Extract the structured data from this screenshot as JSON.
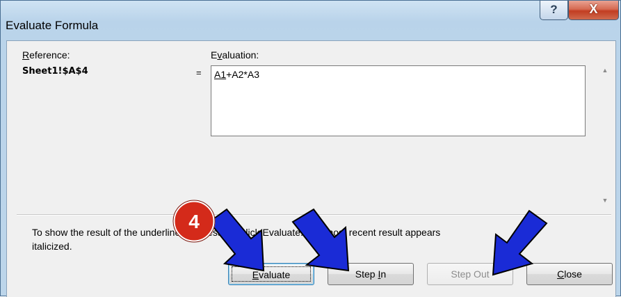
{
  "window": {
    "title": "Evaluate Formula",
    "help_glyph": "?",
    "close_glyph": "X"
  },
  "reference": {
    "label_access": "R",
    "label_rest": "eference:",
    "value": "Sheet1!$A$4",
    "equals": "="
  },
  "evaluation": {
    "label_pre": "E",
    "label_access": "v",
    "label_rest": "aluation:",
    "formula_underlined": "A1",
    "formula_rest": "+A2*A3"
  },
  "help_text": {
    "line1": "To show the result of the underlined expression, click Evaluate.  The most recent result appears",
    "line2": "italicized."
  },
  "buttons": {
    "evaluate": {
      "access": "E",
      "rest": "valuate"
    },
    "step_in": {
      "pre": "Step ",
      "access": "I",
      "rest": "n"
    },
    "step_out": {
      "label": "Step Out",
      "disabled": true
    },
    "close": {
      "access": "C",
      "rest": "lose"
    }
  },
  "callout": {
    "step_number": "4",
    "badge_color": "#d42a1a",
    "arrow_color": "#1a2bd6"
  }
}
